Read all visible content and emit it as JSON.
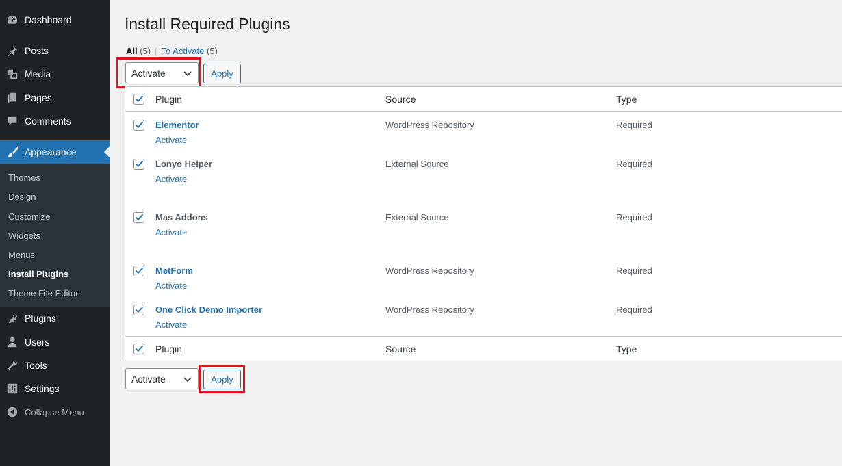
{
  "sidebar": {
    "items": [
      {
        "label": "Dashboard",
        "icon": "dashboard-icon"
      },
      {
        "label": "Posts",
        "icon": "pin-icon"
      },
      {
        "label": "Media",
        "icon": "media-icon"
      },
      {
        "label": "Pages",
        "icon": "pages-icon"
      },
      {
        "label": "Comments",
        "icon": "comments-icon"
      },
      {
        "label": "Appearance",
        "icon": "paintbrush-icon"
      },
      {
        "label": "Plugins",
        "icon": "plugins-icon"
      },
      {
        "label": "Users",
        "icon": "users-icon"
      },
      {
        "label": "Tools",
        "icon": "wrench-icon"
      },
      {
        "label": "Settings",
        "icon": "settings-icon"
      }
    ],
    "submenu": [
      "Themes",
      "Design",
      "Customize",
      "Widgets",
      "Menus",
      "Install Plugins",
      "Theme File Editor"
    ],
    "collapse_label": "Collapse Menu"
  },
  "page": {
    "title": "Install Required Plugins",
    "filters": {
      "all_label": "All",
      "all_count": "(5)",
      "to_activate_label": "To Activate",
      "to_activate_count": "(5)"
    },
    "bulk_action_value": "Activate",
    "apply_label": "Apply"
  },
  "table": {
    "headers": {
      "plugin": "Plugin",
      "source": "Source",
      "type": "Type"
    },
    "rows": [
      {
        "name": "Elementor",
        "action": "Activate",
        "source": "WordPress Repository",
        "type": "Required",
        "checked": true
      },
      {
        "name": "Lonyo Helper",
        "action": "Activate",
        "source": "External Source",
        "type": "Required",
        "checked": true
      },
      {
        "name": "Mas Addons",
        "action": "Activate",
        "source": "External Source",
        "type": "Required",
        "checked": true
      },
      {
        "name": "MetForm",
        "action": "Activate",
        "source": "WordPress Repository",
        "type": "Required",
        "checked": true
      },
      {
        "name": "One Click Demo Importer",
        "action": "Activate",
        "source": "WordPress Repository",
        "type": "Required",
        "checked": true
      }
    ]
  },
  "colors": {
    "sidebar_bg": "#1d2327",
    "accent": "#2271b1",
    "highlight": "#e0141e"
  }
}
